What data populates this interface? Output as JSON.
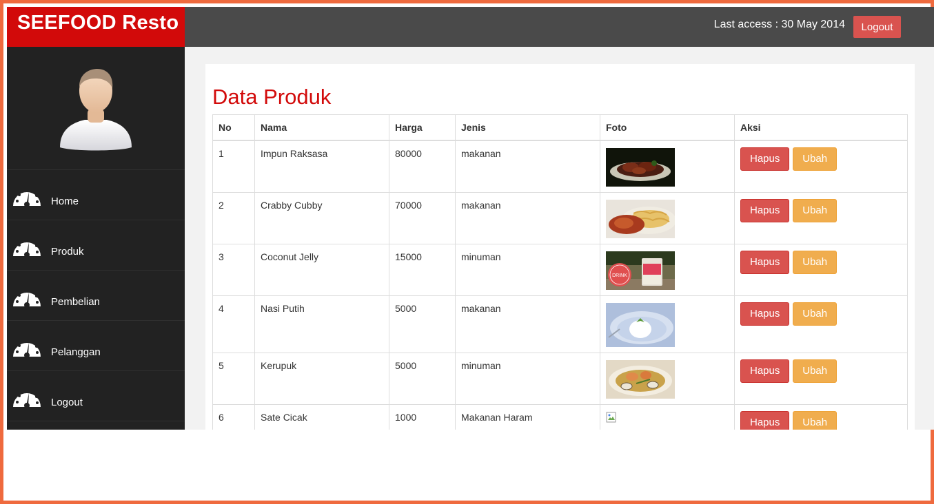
{
  "app": {
    "brand": "SEEFOOD Resto",
    "last_access": "Last access : 30 May 2014",
    "logout_label": "Logout"
  },
  "sidebar": {
    "avatar_icon": "user-avatar",
    "items": [
      {
        "label": "Home",
        "icon": "dashboard-gauge-icon"
      },
      {
        "label": "Produk",
        "icon": "dashboard-gauge-icon"
      },
      {
        "label": "Pembelian",
        "icon": "dashboard-gauge-icon"
      },
      {
        "label": "Pelanggan",
        "icon": "dashboard-gauge-icon"
      },
      {
        "label": "Logout",
        "icon": "dashboard-gauge-icon"
      }
    ]
  },
  "main": {
    "title": "Data Produk",
    "columns": [
      "No",
      "Nama",
      "Harga",
      "Jenis",
      "Foto",
      "Aksi"
    ],
    "rows": [
      {
        "no": "1",
        "nama": "Impun Raksasa",
        "harga": "80000",
        "jenis": "makanan"
      },
      {
        "no": "2",
        "nama": "Crabby Cubby",
        "harga": "70000",
        "jenis": "makanan"
      },
      {
        "no": "3",
        "nama": "Coconut Jelly",
        "harga": "15000",
        "jenis": "minuman"
      },
      {
        "no": "4",
        "nama": "Nasi Putih",
        "harga": "5000",
        "jenis": "makanan"
      },
      {
        "no": "5",
        "nama": "Kerupuk",
        "harga": "5000",
        "jenis": "minuman"
      },
      {
        "no": "6",
        "nama": "Sate Cicak",
        "harga": "1000",
        "jenis": "Makanan Haram"
      }
    ],
    "photo_badge": "DRINK",
    "delete_label": "Hapus",
    "edit_label": "Ubah"
  },
  "colors": {
    "brand_red": "#d20a0a",
    "topbar": "#4a4a4a",
    "sidebar": "#222222",
    "danger": "#d9534f",
    "warning": "#f0ad4e",
    "frame": "#ef6a3e"
  }
}
